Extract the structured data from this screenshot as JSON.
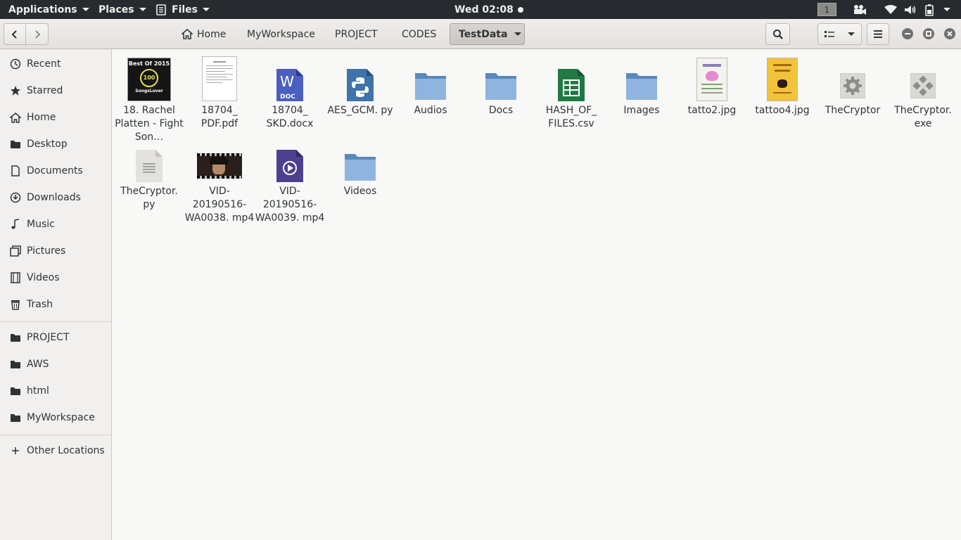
{
  "topbar": {
    "applications": "Applications",
    "places": "Places",
    "files": "Files",
    "clock": "Wed 02:08",
    "workspace": "1",
    "tray_icons": [
      "video-camera-icon",
      "wifi-icon",
      "volume-icon",
      "battery-icon",
      "system-menu-arrow-icon"
    ]
  },
  "header": {
    "breadcrumbs": [
      "Home",
      "MyWorkspace",
      "PROJECT",
      "CODES",
      "TestData"
    ],
    "active_crumb": "TestData"
  },
  "sidebar": {
    "places": [
      {
        "label": "Recent",
        "icon": "clock-icon"
      },
      {
        "label": "Starred",
        "icon": "star-icon"
      },
      {
        "label": "Home",
        "icon": "home-icon"
      },
      {
        "label": "Desktop",
        "icon": "folder-icon"
      },
      {
        "label": "Documents",
        "icon": "document-icon"
      },
      {
        "label": "Downloads",
        "icon": "download-icon"
      },
      {
        "label": "Music",
        "icon": "music-icon"
      },
      {
        "label": "Pictures",
        "icon": "pictures-icon"
      },
      {
        "label": "Videos",
        "icon": "film-icon"
      },
      {
        "label": "Trash",
        "icon": "trash-icon"
      }
    ],
    "bookmarks": [
      {
        "label": "PROJECT",
        "icon": "folder-icon"
      },
      {
        "label": "AWS",
        "icon": "folder-icon"
      },
      {
        "label": "html",
        "icon": "folder-icon"
      },
      {
        "label": "MyWorkspace",
        "icon": "folder-icon"
      }
    ],
    "other_locations": "Other Locations"
  },
  "files": [
    {
      "name": "18. Rachel Platten - Fight Son…",
      "type": "audio-album-art",
      "art_text_top": "Best Of 2015",
      "art_text_mid": "100",
      "art_text_bottom": "SongsLover"
    },
    {
      "name": "18704_ PDF.pdf",
      "type": "pdf"
    },
    {
      "name": "18704_ SKD.docx",
      "type": "docx",
      "badge": "DOC"
    },
    {
      "name": "AES_GCM. py",
      "type": "python"
    },
    {
      "name": "Audios",
      "type": "folder"
    },
    {
      "name": "Docs",
      "type": "folder"
    },
    {
      "name": "HASH_OF_ FILES.csv",
      "type": "csv"
    },
    {
      "name": "Images",
      "type": "folder"
    },
    {
      "name": "tatto2.jpg",
      "type": "image-light"
    },
    {
      "name": "tattoo4.jpg",
      "type": "image-yellow"
    },
    {
      "name": "TheCryptor",
      "type": "executable"
    },
    {
      "name": "TheCryptor. exe",
      "type": "exe"
    },
    {
      "name": "TheCryptor. py",
      "type": "text"
    },
    {
      "name": "VID- 20190516- WA0038. mp4",
      "type": "video-thumb"
    },
    {
      "name": "VID- 20190516- WA0039. mp4",
      "type": "video"
    },
    {
      "name": "Videos",
      "type": "folder"
    }
  ]
}
